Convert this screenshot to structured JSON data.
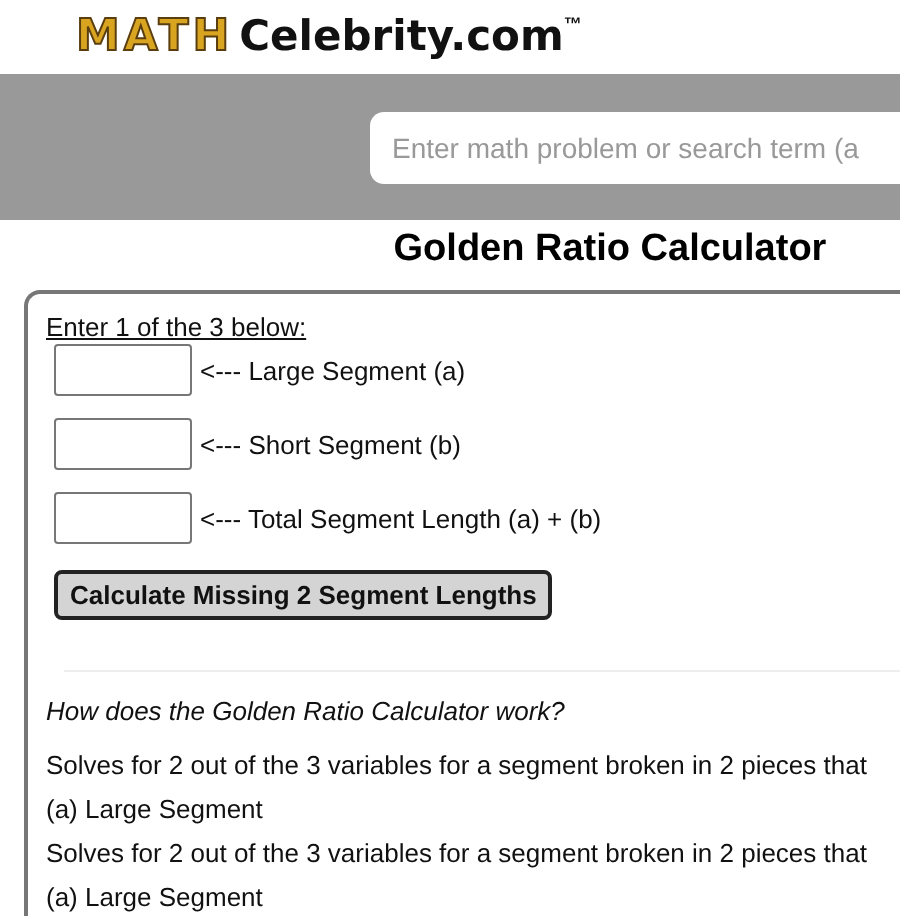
{
  "logo": {
    "brand": "MATH",
    "site": "Celebrity.com",
    "mark": "™"
  },
  "search": {
    "placeholder": "Enter math problem or search term (a"
  },
  "title": "Golden Ratio Calculator",
  "form": {
    "instruction": "Enter 1 of the 3 below:",
    "fields": [
      {
        "label": "<--- Large Segment (a)"
      },
      {
        "label": "<--- Short Segment (b)"
      },
      {
        "label": "<--- Total Segment Length (a) + (b)"
      }
    ],
    "button": "Calculate Missing 2 Segment Lengths"
  },
  "explanation": {
    "question": "How does the Golden Ratio Calculator work?",
    "paragraphs": [
      {
        "lines": [
          "Solves for 2 out of the 3 variables for a segment broken in 2 pieces that",
          "(a) Large Segment"
        ]
      },
      {
        "lines": [
          "Solves for 2 out of the 3 variables for a segment broken in 2 pieces that",
          "(a) Large Segment"
        ]
      }
    ]
  }
}
